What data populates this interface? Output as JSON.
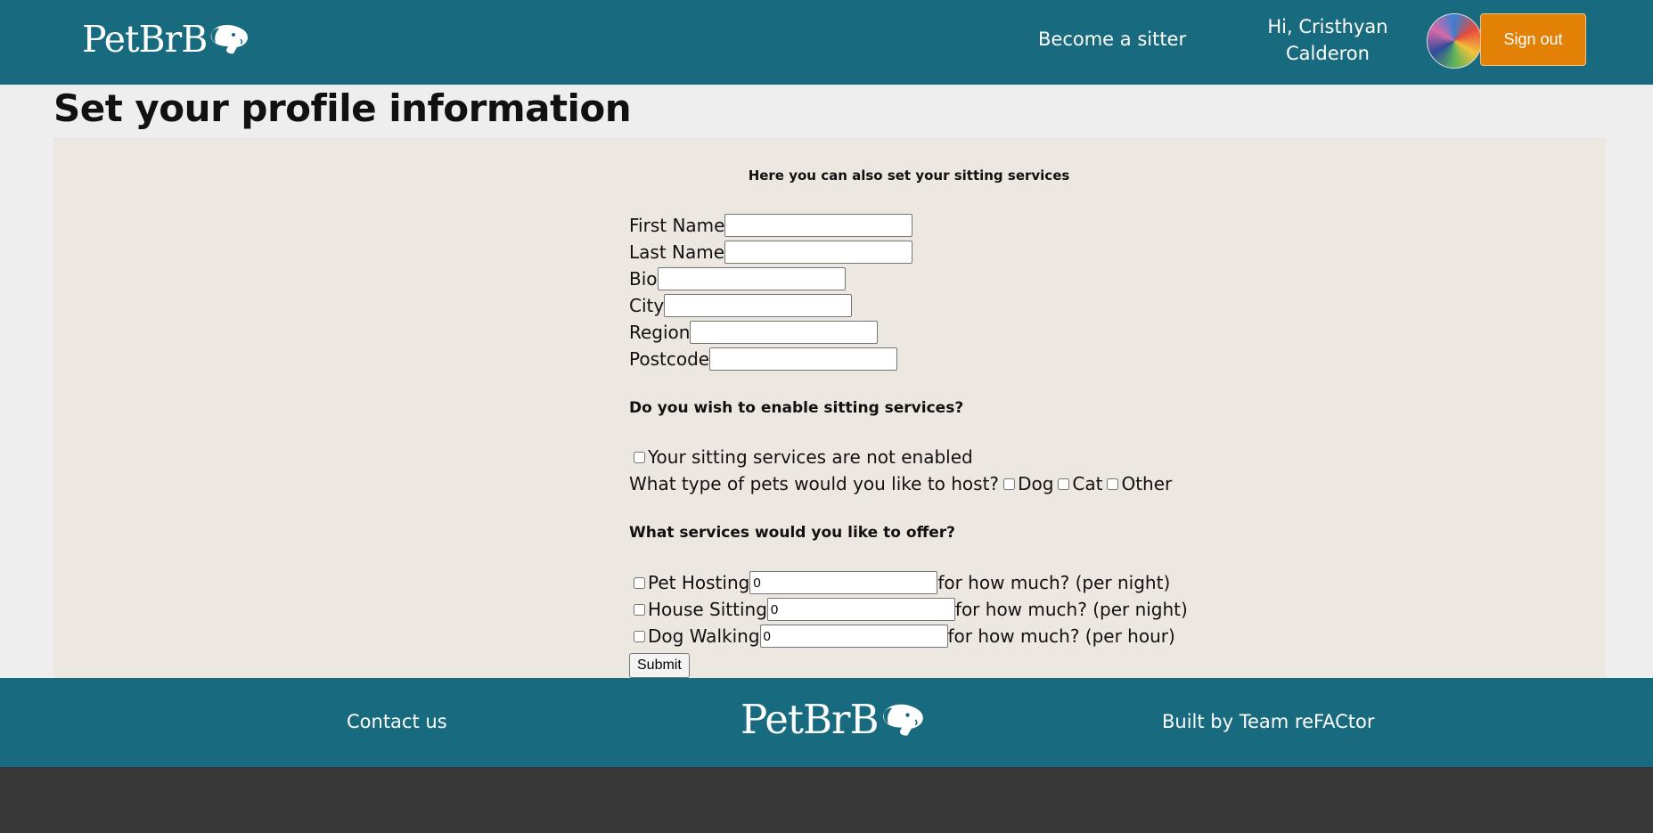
{
  "header": {
    "logo_text": "PetBrB",
    "become_sitter": "Become a sitter",
    "greeting_line1": "Hi, Cristhyan",
    "greeting_line2": "Calderon",
    "sign_out": "Sign out"
  },
  "page": {
    "title": "Set your profile information",
    "subtitle": "Here you can also set your sitting services"
  },
  "form": {
    "first_name_label": "First Name",
    "first_name_value": "",
    "last_name_label": "Last Name",
    "last_name_value": "",
    "bio_label": "Bio",
    "bio_value": "",
    "city_label": "City",
    "city_value": "",
    "region_label": "Region",
    "region_value": "",
    "postcode_label": "Postcode",
    "postcode_value": "",
    "enable_heading": "Do you wish to enable sitting services?",
    "enable_checkbox_label": "Your sitting services are not enabled",
    "pets_question": "What type of pets would you like to host?",
    "pet_dog": "Dog",
    "pet_cat": "Cat",
    "pet_other": "Other",
    "services_heading": "What services would you like to offer?",
    "service_hosting_label": "Pet Hosting",
    "service_hosting_price": "0",
    "service_hosting_suffix": "for how much? (per night)",
    "service_house_label": "House Sitting",
    "service_house_price": "0",
    "service_house_suffix": "for how much? (per night)",
    "service_walking_label": "Dog Walking",
    "service_walking_price": "0",
    "service_walking_suffix": "for how much? (per hour)",
    "submit": "Submit"
  },
  "footer": {
    "contact": "Contact us",
    "logo_text": "PetBrB",
    "built_by": "Built by Team reFACtor"
  },
  "icons": {
    "logo_mark": "dog-head-icon"
  }
}
